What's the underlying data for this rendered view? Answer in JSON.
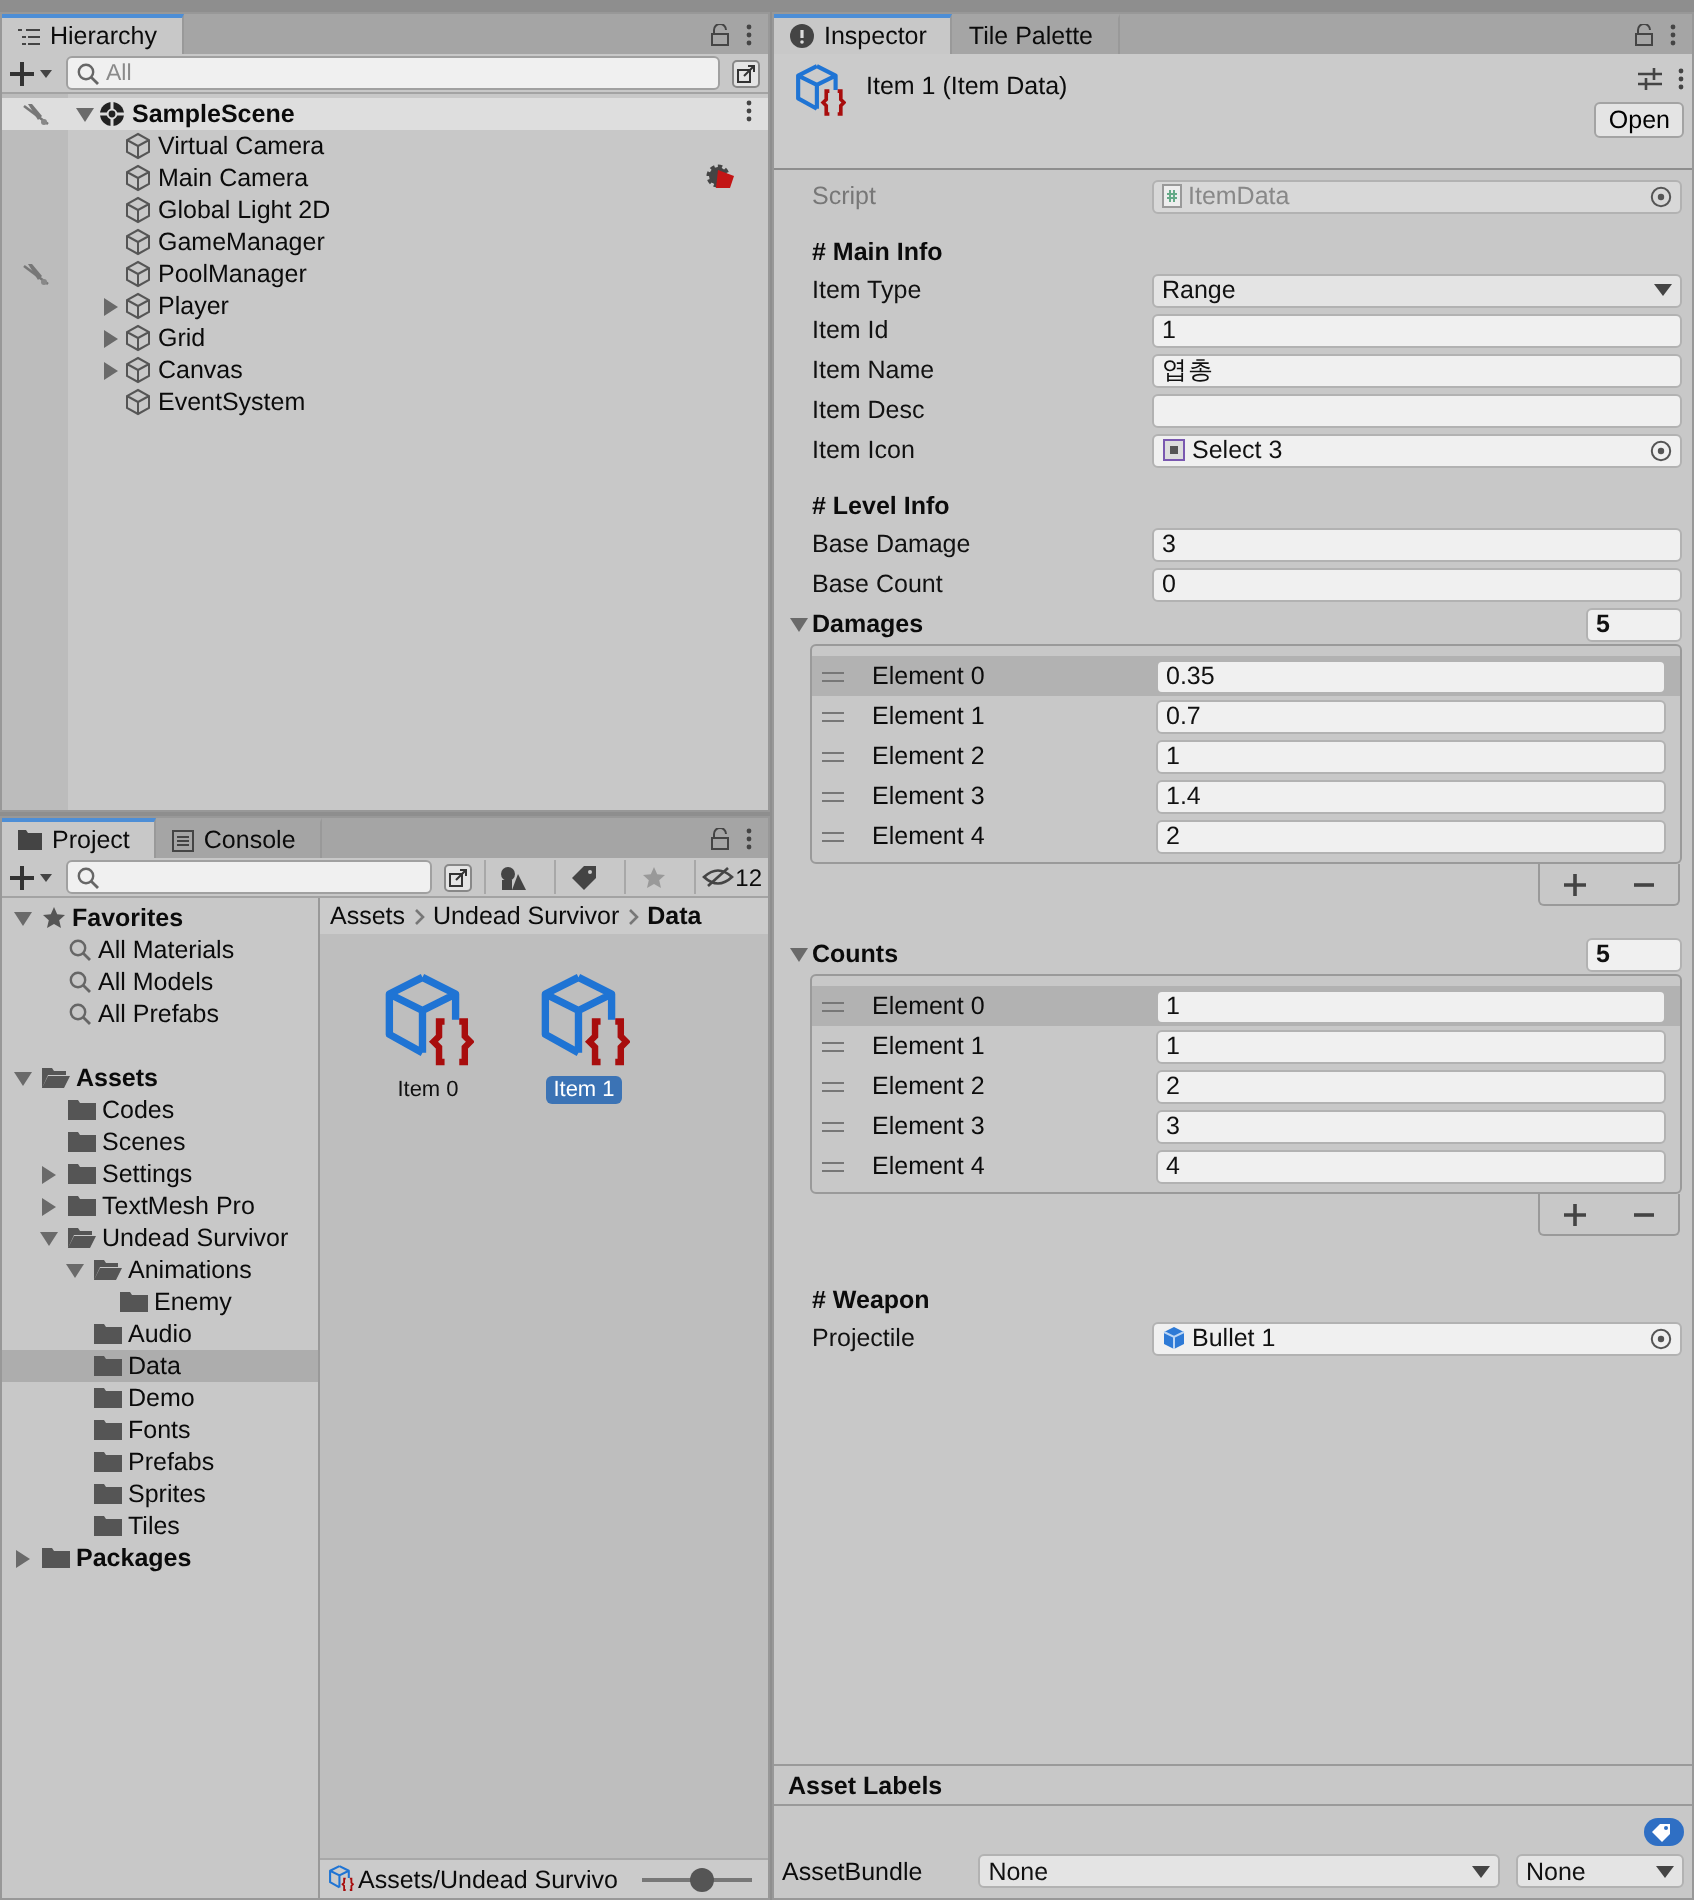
{
  "hierarchy": {
    "tabs": [
      {
        "label": "Hierarchy",
        "selected": true
      }
    ],
    "search": {
      "placeholder": "All"
    },
    "scene": {
      "name": "SampleScene",
      "expanded": true,
      "pickable": false
    },
    "items": [
      {
        "name": "Virtual Camera",
        "pickable": true,
        "gizmo": false
      },
      {
        "name": "Main Camera",
        "pickable": true,
        "gizmo": true
      },
      {
        "name": "Global Light 2D",
        "pickable": true,
        "gizmo": false
      },
      {
        "name": "GameManager",
        "pickable": true,
        "gizmo": false
      },
      {
        "name": "PoolManager",
        "pickable": false,
        "gizmo": false
      },
      {
        "name": "Player",
        "expanded": false,
        "pickable": true,
        "gizmo": false
      },
      {
        "name": "Grid",
        "expanded": false,
        "pickable": true,
        "gizmo": false
      },
      {
        "name": "Canvas",
        "expanded": false,
        "pickable": true,
        "gizmo": false
      },
      {
        "name": "EventSystem",
        "pickable": true,
        "gizmo": false
      }
    ]
  },
  "project": {
    "tabs": [
      {
        "label": "Project",
        "kind": "project",
        "selected": true
      },
      {
        "label": "Console",
        "kind": "console",
        "selected": false
      }
    ],
    "hidden_count": "12",
    "tree": [
      {
        "name": "Favorites",
        "kind": "favorites",
        "expanded": true,
        "selected": false,
        "children": [
          {
            "name": "All Materials",
            "kind": "search",
            "selected": false
          },
          {
            "name": "All Models",
            "kind": "search",
            "selected": false
          },
          {
            "name": "All Prefabs",
            "kind": "search",
            "selected": false
          }
        ]
      },
      {
        "name": "Assets",
        "kind": "folder",
        "expanded": true,
        "selected": false,
        "children": [
          {
            "name": "Codes",
            "kind": "folder",
            "selected": false
          },
          {
            "name": "Scenes",
            "kind": "folder",
            "selected": false
          },
          {
            "name": "Settings",
            "kind": "folder",
            "expanded": false,
            "selected": false
          },
          {
            "name": "TextMesh Pro",
            "kind": "folder",
            "expanded": false,
            "selected": false
          },
          {
            "name": "Undead Survivor",
            "kind": "folder",
            "expanded": true,
            "selected": false,
            "children": [
              {
                "name": "Animations",
                "kind": "folder",
                "expanded": true,
                "selected": false,
                "children": [
                  {
                    "name": "Enemy",
                    "kind": "folder",
                    "selected": false
                  }
                ]
              },
              {
                "name": "Audio",
                "kind": "folder",
                "selected": false
              },
              {
                "name": "Data",
                "kind": "folder",
                "selected": true
              },
              {
                "name": "Demo",
                "kind": "folder",
                "selected": false
              },
              {
                "name": "Fonts",
                "kind": "folder",
                "selected": false
              },
              {
                "name": "Prefabs",
                "kind": "folder",
                "selected": false
              },
              {
                "name": "Sprites",
                "kind": "folder",
                "selected": false
              },
              {
                "name": "Tiles",
                "kind": "folder",
                "selected": false
              }
            ]
          }
        ]
      },
      {
        "name": "Packages",
        "kind": "folder",
        "expanded": false,
        "selected": false
      }
    ],
    "breadcrumb": [
      "Assets",
      "Undead Survivor",
      "Data"
    ],
    "assets": [
      {
        "name": "Item 0",
        "selected": false
      },
      {
        "name": "Item 1",
        "selected": true
      }
    ],
    "footer": {
      "path": "Assets/Undead Survivo",
      "zoom": {
        "level": 0.55
      }
    }
  },
  "inspector": {
    "tabs": [
      {
        "label": "Inspector",
        "kind": "info",
        "selected": true
      },
      {
        "label": "Tile Palette",
        "kind": "plain",
        "selected": false
      }
    ],
    "title": "Item 1 (Item Data)",
    "open_button": "Open",
    "rows": [
      {
        "kind": "object",
        "label": "Script",
        "value": "ItemData",
        "disabled": true
      },
      {
        "kind": "header",
        "label": "# Main Info"
      },
      {
        "kind": "dropdown",
        "label": "Item Type",
        "value": "Range"
      },
      {
        "kind": "text",
        "label": "Item Id",
        "value": "1"
      },
      {
        "kind": "text",
        "label": "Item Name",
        "value": "엽총"
      },
      {
        "kind": "text",
        "label": "Item Desc"
      },
      {
        "kind": "object",
        "label": "Item Icon",
        "value": "Select 3",
        "disabled": false
      },
      {
        "kind": "header",
        "label": "# Level Info"
      },
      {
        "kind": "text",
        "label": "Base Damage",
        "value": "3"
      },
      {
        "kind": "text",
        "label": "Base Count",
        "value": "0"
      },
      {
        "kind": "array",
        "label": "Damages",
        "expanded": true,
        "size": "5",
        "elements": [
          {
            "label": "Element 0",
            "value": "0.35",
            "selected": true
          },
          {
            "label": "Element 1",
            "value": "0.7",
            "selected": false
          },
          {
            "label": "Element 2",
            "value": "1",
            "selected": false
          },
          {
            "label": "Element 3",
            "value": "1.4",
            "selected": false
          },
          {
            "label": "Element 4",
            "value": "2",
            "selected": false
          }
        ]
      },
      {
        "kind": "array",
        "label": "Counts",
        "expanded": true,
        "size": "5",
        "elements": [
          {
            "label": "Element 0",
            "value": "1",
            "selected": true
          },
          {
            "label": "Element 1",
            "value": "1",
            "selected": false
          },
          {
            "label": "Element 2",
            "value": "2",
            "selected": false
          },
          {
            "label": "Element 3",
            "value": "3",
            "selected": false
          },
          {
            "label": "Element 4",
            "value": "4",
            "selected": false
          }
        ]
      },
      {
        "kind": "header",
        "label": "# Weapon"
      },
      {
        "kind": "object",
        "label": "Projectile",
        "value": "Bullet 1",
        "disabled": false
      }
    ],
    "asset_labels": {
      "title": "Asset Labels",
      "bundle_label": "AssetBundle",
      "bundle": "None",
      "variant": "None"
    }
  }
}
